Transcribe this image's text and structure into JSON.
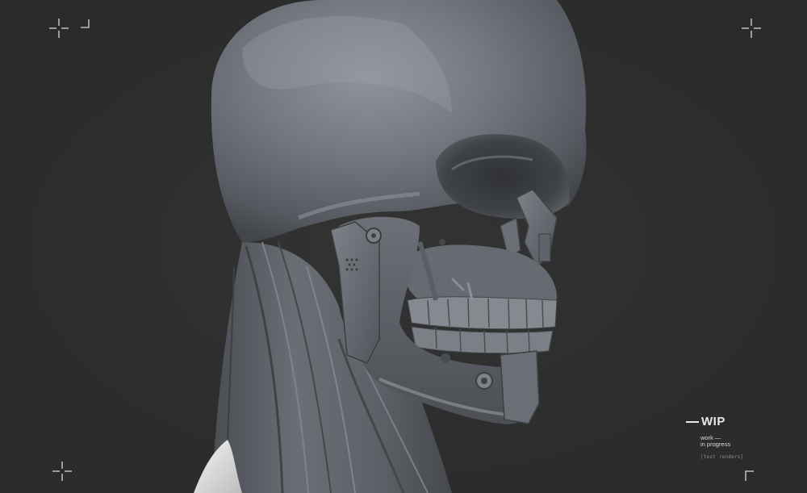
{
  "background_color": "#2e2e2e",
  "sculpt": {
    "subject": "cyborg skull with mechanical jaw plates and neck muscles",
    "material": "matte grey clay",
    "base_color": "#6f737a",
    "highlight_color": "#9ea3aa",
    "shadow_color": "#3c3f44",
    "collar_color": "#e6e6e6"
  },
  "crop_markers": {
    "color": "#d8d8d8",
    "top_left_icon": "crosshair-plus-icon",
    "top_left_corner_icon": "corner-bracket-icon",
    "top_right_icon": "crosshair-plus-icon",
    "bottom_left_icon": "crosshair-plus-icon",
    "bottom_right_icon": "corner-bracket-icon"
  },
  "label": {
    "title": "WIP",
    "subtitle_line1": "work —",
    "subtitle_line2": "in progress",
    "note": "[test renders]"
  }
}
